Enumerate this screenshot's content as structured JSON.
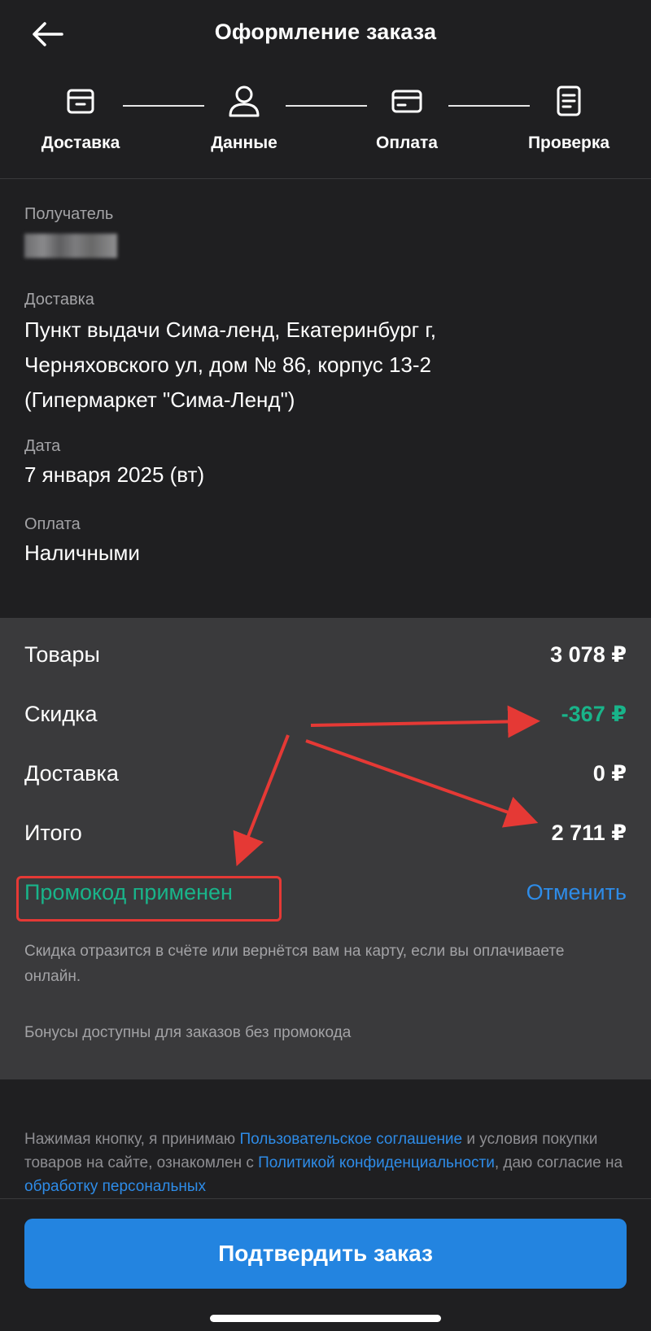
{
  "header": {
    "title": "Оформление заказа"
  },
  "stepper": {
    "steps": [
      {
        "label": "Доставка",
        "icon": "box-icon"
      },
      {
        "label": "Данные",
        "icon": "user-icon"
      },
      {
        "label": "Оплата",
        "icon": "credit-card-icon"
      },
      {
        "label": "Проверка",
        "icon": "document-icon"
      }
    ]
  },
  "info": {
    "recipient_caption": "Получатель",
    "delivery_caption": "Доставка",
    "delivery_lines": [
      "Пункт выдачи Сима-ленд,  Екатеринбург г,",
      "Черняховского ул, дом № 86, корпус 13-2",
      "(Гипермаркет \"Сима-Ленд\")"
    ],
    "date_caption": "Дата",
    "date_value": "7 января 2025 (вт)",
    "payment_caption": "Оплата",
    "payment_value": "Наличными"
  },
  "summary": {
    "goods_label": "Товары",
    "goods_amount": "3 078 ₽",
    "discount_label": "Скидка",
    "discount_amount": "-367 ₽",
    "delivery_label": "Доставка",
    "delivery_amount": "0 ₽",
    "total_label": "Итого",
    "total_amount": "2 711 ₽",
    "promo_status": "Промокод применен",
    "cancel_label": "Отменить",
    "note_refund": "Скидка отразится в счёте или вернётся вам на карту, если вы оплачиваете онлайн.",
    "note_bonus": "Бонусы доступны для заказов без промокода"
  },
  "legal": {
    "t1": "Нажимая кнопку, я принимаю ",
    "link1": "Пользовательское соглашение",
    "t2": " и условия покупки товаров на сайте, ознакомлен с ",
    "link2": "Политикой конфиденциальности",
    "t3": ",  даю согласие на ",
    "link3": "обработку персональных"
  },
  "footer": {
    "confirm_label": "Подтвердить заказ"
  },
  "colors": {
    "background": "#1f1f21",
    "summary_bg": "#3a3a3c",
    "accent_blue": "#2384e0",
    "discount_green": "#19b48a",
    "annotation_red": "#e53935"
  }
}
